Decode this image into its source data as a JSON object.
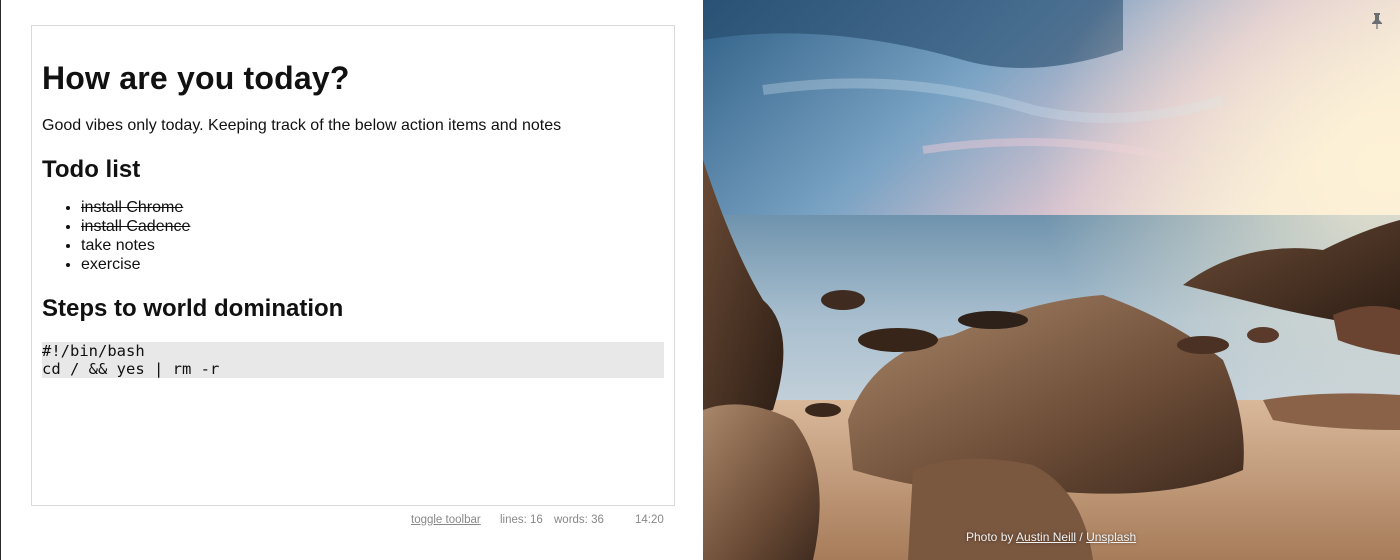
{
  "editor": {
    "heading": "How are you today?",
    "intro": "Good vibes only today. Keeping track of the below action items and notes",
    "todo_heading": "Todo list",
    "todos": [
      {
        "text": "install Chrome",
        "done": true
      },
      {
        "text": "install Cadence",
        "done": true
      },
      {
        "text": "take notes",
        "done": false
      },
      {
        "text": "exercise",
        "done": false
      }
    ],
    "steps_heading": "Steps to world domination",
    "code_lines": [
      "#!/bin/bash",
      "cd / && yes | rm -r"
    ]
  },
  "statusbar": {
    "toggle_label": "toggle toolbar",
    "lines": "lines: 16",
    "words": "words: 36",
    "time": "14:20"
  },
  "photo": {
    "credit_prefix": "Photo by ",
    "author": "Austin Neill",
    "separator": " / ",
    "source": "Unsplash",
    "pin_icon": "pin-icon"
  }
}
